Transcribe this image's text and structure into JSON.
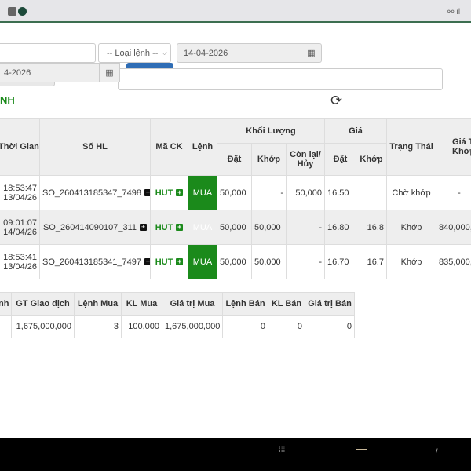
{
  "filters": {
    "order_type_placeholder": "-- Loại lệnh --",
    "to_date": "14-04-2026",
    "from_date": "4-2026"
  },
  "section_title": "NH",
  "orders": {
    "headers": {
      "time": "Thời Gian",
      "order_no": "Số HL",
      "symbol": "Mã CK",
      "side": "Lệnh",
      "volume": "Khối Lượng",
      "price": "Giá",
      "status": "Trạng Thái",
      "matched_value": "Giá Trị Khớp",
      "vol_placed": "Đặt",
      "vol_matched": "Khớp",
      "vol_remaining": "Còn lại/ Hủy",
      "price_placed": "Đặt",
      "price_matched": "Khớp"
    },
    "rows": [
      {
        "time": "18:53:47",
        "date": "13/04/26",
        "order_no": "SO_260413185347_7498",
        "symbol": "HUT",
        "side": "MUA",
        "vol_placed": "50,000",
        "vol_matched": "-",
        "vol_remaining": "50,000",
        "price_placed": "16.50",
        "price_matched": "",
        "status": "Chờ khớp",
        "matched_value": "-"
      },
      {
        "time": "09:01:07",
        "date": "14/04/26",
        "order_no": "SO_260414090107_311",
        "symbol": "HUT",
        "side": "MUA",
        "vol_placed": "50,000",
        "vol_matched": "50,000",
        "vol_remaining": "-",
        "price_placed": "16.80",
        "price_matched": "16.8",
        "status": "Khớp",
        "matched_value": "840,000,"
      },
      {
        "time": "18:53:41",
        "date": "13/04/26",
        "order_no": "SO_260413185341_7497",
        "symbol": "HUT",
        "side": "MUA",
        "vol_placed": "50,000",
        "vol_matched": "50,000",
        "vol_remaining": "-",
        "price_placed": "16.70",
        "price_matched": "16.7",
        "status": "Khớp",
        "matched_value": "835,000,"
      }
    ]
  },
  "summary": {
    "headers": [
      "nh",
      "GT Giao dịch",
      "Lệnh Mua",
      "KL Mua",
      "Giá trị Mua",
      "Lệnh Bán",
      "KL Bán",
      "Giá trị Bán"
    ],
    "row": [
      "",
      "1,675,000,000",
      "3",
      "100,000",
      "1,675,000,000",
      "0",
      "0",
      "0"
    ]
  }
}
